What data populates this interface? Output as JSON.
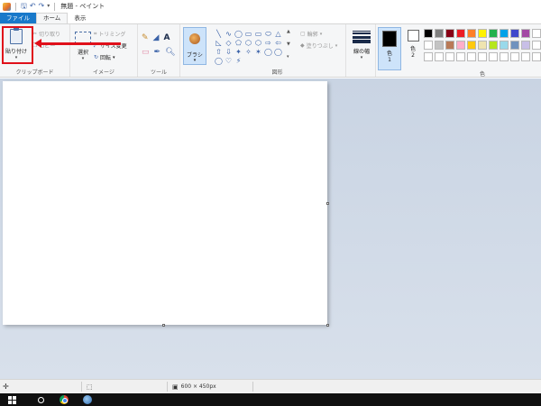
{
  "window": {
    "title": "無題 - ペイント"
  },
  "tabs": [
    {
      "label": "ファイル"
    },
    {
      "label": "ホーム"
    },
    {
      "label": "表示"
    }
  ],
  "ribbon": {
    "clipboard": {
      "group_label": "クリップボード",
      "paste_label": "貼り付け",
      "cut_label": "切り取り",
      "copy_label": "コピー"
    },
    "image": {
      "group_label": "イメージ",
      "select_label": "選択",
      "crop_label": "トリミング",
      "resize_label": "サイズ変更",
      "rotate_label": "回転"
    },
    "tools": {
      "group_label": "ツール",
      "text_tool": "A"
    },
    "brushes": {
      "label": "ブラシ"
    },
    "shapes": {
      "group_label": "図形",
      "outline_label": "輪郭",
      "fill_label": "塗りつぶし",
      "glyphs": [
        "╲",
        "∿",
        "◯",
        "▭",
        "▭",
        "⬭",
        "△",
        "◺",
        "◇",
        "⬠",
        "⬡",
        "⬡",
        "⇨",
        "⇦",
        "⇧",
        "⇩",
        "✦",
        "✧",
        "✶",
        "◯",
        "◯",
        "◯",
        "♡",
        "⚡"
      ]
    },
    "size": {
      "label": "線の幅"
    },
    "colors": {
      "group_label": "色",
      "color1_label": "色\n1",
      "color2_label": "色\n2",
      "color1_value": "#000000",
      "color2_value": "#ffffff",
      "palette": [
        "#000000",
        "#7f7f7f",
        "#880015",
        "#ed1c24",
        "#ff7f27",
        "#fff200",
        "#22b14c",
        "#00a2e8",
        "#3f48cc",
        "#a349a4",
        "#ffffff",
        "#ffffff",
        "#c3c3c3",
        "#b97a57",
        "#ffaec9",
        "#ffc90e",
        "#efe4b0",
        "#b5e61d",
        "#99d9ea",
        "#7092be",
        "#c8bfe7",
        "#ffffff",
        "#ffffff",
        "#ffffff",
        "#ffffff",
        "#ffffff",
        "#ffffff",
        "#ffffff",
        "#ffffff",
        "#ffffff",
        "#ffffff",
        "#ffffff",
        "#ffffff"
      ]
    }
  },
  "annotation": {
    "color": "#e0101a"
  },
  "status": {
    "canvas_size": "600 × 450px"
  }
}
